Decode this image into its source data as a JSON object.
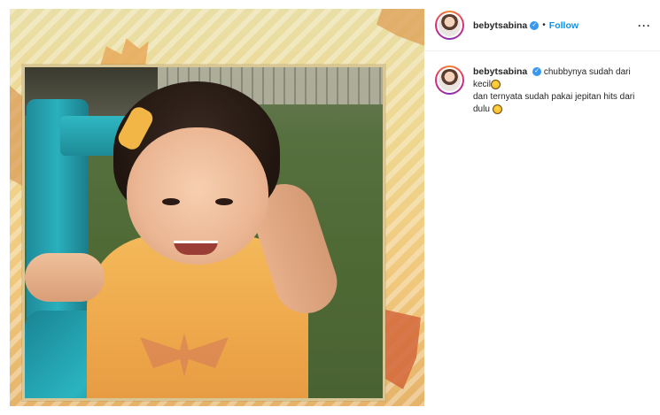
{
  "post": {
    "username": "bebytsabina",
    "verified_symbol": "✓",
    "separator": "•",
    "follow_label": "Follow",
    "more_label": "···"
  },
  "caption": {
    "username": "bebytsabina",
    "line1": "chubbynya sudah dari kecil",
    "line2": "dan ternyata sudah pakai jepitan hits dari dulu",
    "emoji1": "grinning-face-emoji",
    "emoji2": "grinning-face-emoji"
  },
  "colors": {
    "follow": "#0095f6",
    "verified": "#3897f0",
    "text": "#262626",
    "divider": "#efefef"
  },
  "icons": {
    "avatar": "profile-picture",
    "verified": "verified-badge-icon",
    "more": "more-options-icon"
  }
}
